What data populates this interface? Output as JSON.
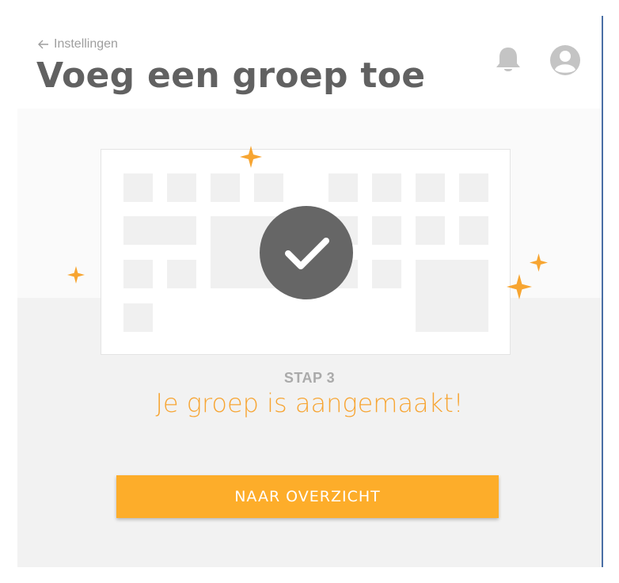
{
  "header": {
    "back_label": "Instellingen",
    "title": "Voeg een groep toe"
  },
  "icons": {
    "back": "arrow-left-icon",
    "notifications": "bell-icon",
    "profile": "user-avatar-icon",
    "success": "checkmark-icon",
    "decoration": "sparkle-icon"
  },
  "step": {
    "label": "STAP 3",
    "message": "Je groep is aangemaakt!"
  },
  "action": {
    "button_label": "NAAR OVERZICHT"
  },
  "colors": {
    "accent": "#fdad2a",
    "message": "#f7a533",
    "title": "#616161",
    "check_circle": "#666666"
  }
}
